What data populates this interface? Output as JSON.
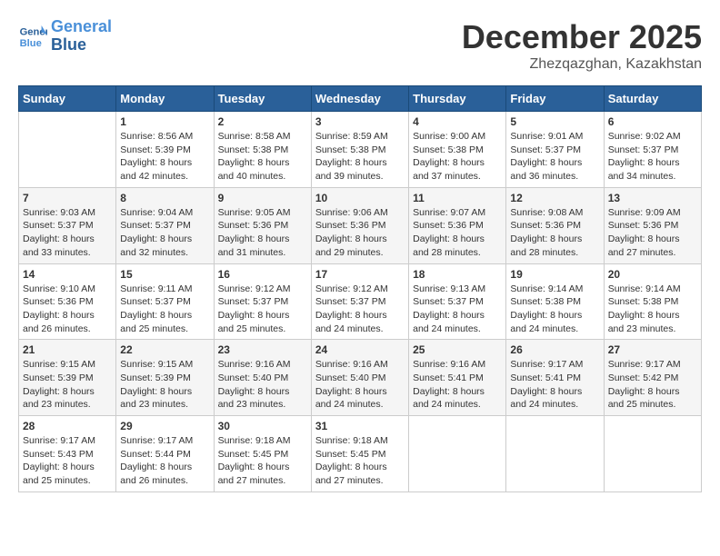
{
  "header": {
    "logo_line1": "General",
    "logo_line2": "Blue",
    "month_title": "December 2025",
    "location": "Zhezqazghan, Kazakhstan"
  },
  "weekdays": [
    "Sunday",
    "Monday",
    "Tuesday",
    "Wednesday",
    "Thursday",
    "Friday",
    "Saturday"
  ],
  "weeks": [
    [
      {
        "day": "",
        "sunrise": "",
        "sunset": "",
        "daylight": ""
      },
      {
        "day": "1",
        "sunrise": "Sunrise: 8:56 AM",
        "sunset": "Sunset: 5:39 PM",
        "daylight": "Daylight: 8 hours and 42 minutes."
      },
      {
        "day": "2",
        "sunrise": "Sunrise: 8:58 AM",
        "sunset": "Sunset: 5:38 PM",
        "daylight": "Daylight: 8 hours and 40 minutes."
      },
      {
        "day": "3",
        "sunrise": "Sunrise: 8:59 AM",
        "sunset": "Sunset: 5:38 PM",
        "daylight": "Daylight: 8 hours and 39 minutes."
      },
      {
        "day": "4",
        "sunrise": "Sunrise: 9:00 AM",
        "sunset": "Sunset: 5:38 PM",
        "daylight": "Daylight: 8 hours and 37 minutes."
      },
      {
        "day": "5",
        "sunrise": "Sunrise: 9:01 AM",
        "sunset": "Sunset: 5:37 PM",
        "daylight": "Daylight: 8 hours and 36 minutes."
      },
      {
        "day": "6",
        "sunrise": "Sunrise: 9:02 AM",
        "sunset": "Sunset: 5:37 PM",
        "daylight": "Daylight: 8 hours and 34 minutes."
      }
    ],
    [
      {
        "day": "7",
        "sunrise": "Sunrise: 9:03 AM",
        "sunset": "Sunset: 5:37 PM",
        "daylight": "Daylight: 8 hours and 33 minutes."
      },
      {
        "day": "8",
        "sunrise": "Sunrise: 9:04 AM",
        "sunset": "Sunset: 5:37 PM",
        "daylight": "Daylight: 8 hours and 32 minutes."
      },
      {
        "day": "9",
        "sunrise": "Sunrise: 9:05 AM",
        "sunset": "Sunset: 5:36 PM",
        "daylight": "Daylight: 8 hours and 31 minutes."
      },
      {
        "day": "10",
        "sunrise": "Sunrise: 9:06 AM",
        "sunset": "Sunset: 5:36 PM",
        "daylight": "Daylight: 8 hours and 29 minutes."
      },
      {
        "day": "11",
        "sunrise": "Sunrise: 9:07 AM",
        "sunset": "Sunset: 5:36 PM",
        "daylight": "Daylight: 8 hours and 28 minutes."
      },
      {
        "day": "12",
        "sunrise": "Sunrise: 9:08 AM",
        "sunset": "Sunset: 5:36 PM",
        "daylight": "Daylight: 8 hours and 28 minutes."
      },
      {
        "day": "13",
        "sunrise": "Sunrise: 9:09 AM",
        "sunset": "Sunset: 5:36 PM",
        "daylight": "Daylight: 8 hours and 27 minutes."
      }
    ],
    [
      {
        "day": "14",
        "sunrise": "Sunrise: 9:10 AM",
        "sunset": "Sunset: 5:36 PM",
        "daylight": "Daylight: 8 hours and 26 minutes."
      },
      {
        "day": "15",
        "sunrise": "Sunrise: 9:11 AM",
        "sunset": "Sunset: 5:37 PM",
        "daylight": "Daylight: 8 hours and 25 minutes."
      },
      {
        "day": "16",
        "sunrise": "Sunrise: 9:12 AM",
        "sunset": "Sunset: 5:37 PM",
        "daylight": "Daylight: 8 hours and 25 minutes."
      },
      {
        "day": "17",
        "sunrise": "Sunrise: 9:12 AM",
        "sunset": "Sunset: 5:37 PM",
        "daylight": "Daylight: 8 hours and 24 minutes."
      },
      {
        "day": "18",
        "sunrise": "Sunrise: 9:13 AM",
        "sunset": "Sunset: 5:37 PM",
        "daylight": "Daylight: 8 hours and 24 minutes."
      },
      {
        "day": "19",
        "sunrise": "Sunrise: 9:14 AM",
        "sunset": "Sunset: 5:38 PM",
        "daylight": "Daylight: 8 hours and 24 minutes."
      },
      {
        "day": "20",
        "sunrise": "Sunrise: 9:14 AM",
        "sunset": "Sunset: 5:38 PM",
        "daylight": "Daylight: 8 hours and 23 minutes."
      }
    ],
    [
      {
        "day": "21",
        "sunrise": "Sunrise: 9:15 AM",
        "sunset": "Sunset: 5:39 PM",
        "daylight": "Daylight: 8 hours and 23 minutes."
      },
      {
        "day": "22",
        "sunrise": "Sunrise: 9:15 AM",
        "sunset": "Sunset: 5:39 PM",
        "daylight": "Daylight: 8 hours and 23 minutes."
      },
      {
        "day": "23",
        "sunrise": "Sunrise: 9:16 AM",
        "sunset": "Sunset: 5:40 PM",
        "daylight": "Daylight: 8 hours and 23 minutes."
      },
      {
        "day": "24",
        "sunrise": "Sunrise: 9:16 AM",
        "sunset": "Sunset: 5:40 PM",
        "daylight": "Daylight: 8 hours and 24 minutes."
      },
      {
        "day": "25",
        "sunrise": "Sunrise: 9:16 AM",
        "sunset": "Sunset: 5:41 PM",
        "daylight": "Daylight: 8 hours and 24 minutes."
      },
      {
        "day": "26",
        "sunrise": "Sunrise: 9:17 AM",
        "sunset": "Sunset: 5:41 PM",
        "daylight": "Daylight: 8 hours and 24 minutes."
      },
      {
        "day": "27",
        "sunrise": "Sunrise: 9:17 AM",
        "sunset": "Sunset: 5:42 PM",
        "daylight": "Daylight: 8 hours and 25 minutes."
      }
    ],
    [
      {
        "day": "28",
        "sunrise": "Sunrise: 9:17 AM",
        "sunset": "Sunset: 5:43 PM",
        "daylight": "Daylight: 8 hours and 25 minutes."
      },
      {
        "day": "29",
        "sunrise": "Sunrise: 9:17 AM",
        "sunset": "Sunset: 5:44 PM",
        "daylight": "Daylight: 8 hours and 26 minutes."
      },
      {
        "day": "30",
        "sunrise": "Sunrise: 9:18 AM",
        "sunset": "Sunset: 5:45 PM",
        "daylight": "Daylight: 8 hours and 27 minutes."
      },
      {
        "day": "31",
        "sunrise": "Sunrise: 9:18 AM",
        "sunset": "Sunset: 5:45 PM",
        "daylight": "Daylight: 8 hours and 27 minutes."
      },
      {
        "day": "",
        "sunrise": "",
        "sunset": "",
        "daylight": ""
      },
      {
        "day": "",
        "sunrise": "",
        "sunset": "",
        "daylight": ""
      },
      {
        "day": "",
        "sunrise": "",
        "sunset": "",
        "daylight": ""
      }
    ]
  ]
}
